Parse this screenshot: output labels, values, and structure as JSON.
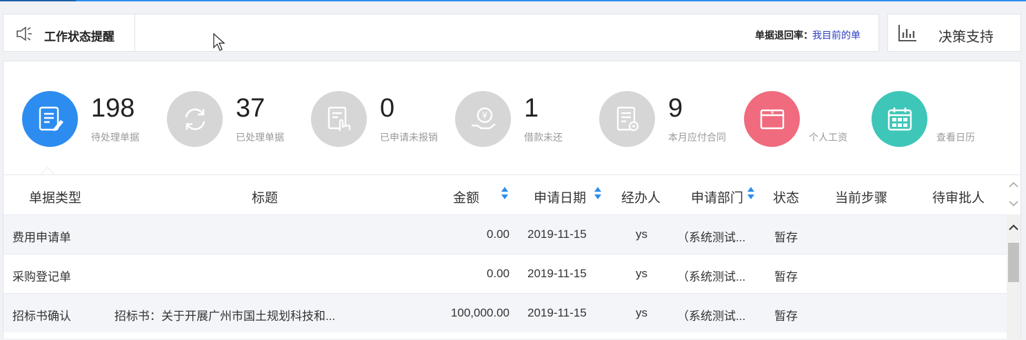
{
  "notice": {
    "title": "工作状态提醒",
    "rate_label": "单据退回率：",
    "rate_link": "我目前的单"
  },
  "decision": {
    "label": "决策支持"
  },
  "stats": [
    {
      "value": "198",
      "caption": "待处理单据",
      "icon": "document-edit-icon",
      "color": "#2d8cf0"
    },
    {
      "value": "37",
      "caption": "已处理单据",
      "icon": "refresh-icon",
      "color": "#d6d6d6"
    },
    {
      "value": "0",
      "caption": "已申请未报销",
      "icon": "document-hand-icon",
      "color": "#d6d6d6"
    },
    {
      "value": "1",
      "caption": "借款未还",
      "icon": "yen-hand-icon",
      "color": "#d6d6d6"
    },
    {
      "value": "9",
      "caption": "本月应付合同",
      "icon": "contract-icon",
      "color": "#d6d6d6"
    }
  ],
  "shortcuts": [
    {
      "caption": "个人工资",
      "icon": "salary-icon",
      "color": "#ef6b7d"
    },
    {
      "caption": "查看日历",
      "icon": "calendar-icon",
      "color": "#3ec6b8"
    }
  ],
  "table": {
    "columns": [
      "单据类型",
      "标题",
      "金额",
      "申请日期",
      "经办人",
      "申请部门",
      "状态",
      "当前步骤",
      "待审批人"
    ],
    "rows": [
      {
        "type": "费用申请单",
        "title": "",
        "amount": "0.00",
        "date": "2019-11-15",
        "handler": "ys",
        "dept": "（系统测试...",
        "status": "暂存",
        "step": "",
        "approver": ""
      },
      {
        "type": "采购登记单",
        "title": "",
        "amount": "0.00",
        "date": "2019-11-15",
        "handler": "ys",
        "dept": "（系统测试...",
        "status": "暂存",
        "step": "",
        "approver": ""
      },
      {
        "type": "招标书确认",
        "title": "招标书：关于开展广州市国土规划科技和...",
        "amount": "100,000.00",
        "date": "2019-11-15",
        "handler": "ys",
        "dept": "（系统测试...",
        "status": "暂存",
        "step": "",
        "approver": ""
      }
    ]
  }
}
